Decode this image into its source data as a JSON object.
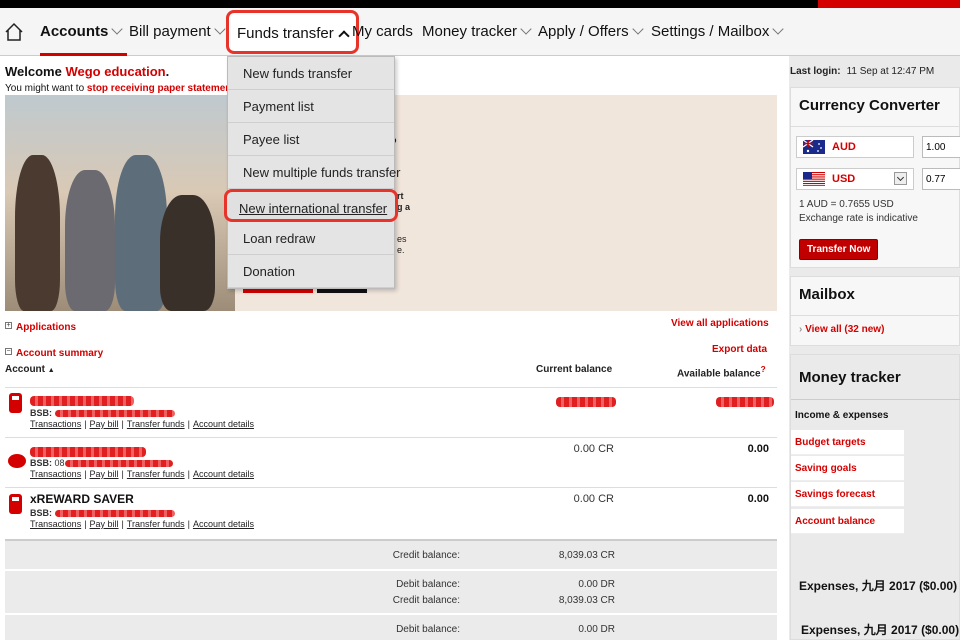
{
  "nav": {
    "items": [
      {
        "label": "Accounts"
      },
      {
        "label": "Bill payment"
      },
      {
        "label": "Funds transfer"
      },
      {
        "label": "My cards"
      },
      {
        "label": "Money tracker"
      },
      {
        "label": "Apply / Offers"
      },
      {
        "label": "Settings / Mailbox"
      }
    ],
    "active": "Accounts",
    "open_menu": "Funds transfer",
    "home_icon": "home-icon"
  },
  "funds_menu": {
    "items": [
      {
        "label": "New funds transfer"
      },
      {
        "label": "Payment list"
      },
      {
        "label": "Payee list"
      },
      {
        "label": "New multiple funds transfer"
      },
      {
        "label": "New international transfer"
      },
      {
        "label": "Loan redraw"
      },
      {
        "label": "Donation"
      }
    ],
    "highlighted": "New international transfer"
  },
  "welcome": {
    "prefix": "Welcome",
    "name": "Wego education",
    "suffix": ".",
    "paper_prefix": "You might want to",
    "paper_link": "stop receiving paper statements"
  },
  "banner": {
    "fragments": [
      "o",
      "rt",
      "g a",
      "es",
      "e."
    ]
  },
  "applications": {
    "label": "Applications",
    "view_all": "View all applications"
  },
  "account_summary": {
    "label": "Account summary",
    "export": "Export data",
    "columns": {
      "account": "Account",
      "current": "Current balance",
      "available": "Available balance"
    },
    "help_mark": "?",
    "row_links": [
      "Transactions",
      "Pay bill",
      "Transfer funds",
      "Account details"
    ],
    "bsb_label": "BSB:",
    "rows": [
      {
        "name": "",
        "bsb_visible": "",
        "current": "",
        "available": "",
        "icon": "calculator-icon"
      },
      {
        "name": "",
        "bsb_visible": "08",
        "current": "0.00 CR",
        "available": "0.00",
        "icon": "piggy-bank-icon"
      },
      {
        "name": "xREWARD SAVER",
        "bsb_visible": "",
        "current": "0.00 CR",
        "available": "0.00",
        "icon": "calculator-icon"
      }
    ],
    "totals": [
      {
        "label": "Credit balance:",
        "value": "8,039.03 CR"
      },
      {
        "label": "Debit balance:",
        "value": "0.00 DR"
      },
      {
        "label": "Credit balance:",
        "value": "8,039.03 CR"
      },
      {
        "label": "Debit balance:",
        "value": "0.00 DR"
      }
    ]
  },
  "sidebar": {
    "last_login_label": "Last login:",
    "last_login_value": "11 Sep at 12:47 PM",
    "currency": {
      "title": "Currency Converter",
      "from_code": "AUD",
      "from_value": "1.00",
      "to_code": "USD",
      "to_value": "0.77",
      "rate": "1 AUD = 0.7655 USD",
      "note": "Exchange rate is indicative",
      "button": "Transfer Now"
    },
    "mailbox": {
      "title": "Mailbox",
      "link": "View all (32 new)"
    },
    "money_tracker": {
      "title": "Money tracker",
      "section": "Income & expenses",
      "items": [
        "Budget targets",
        "Saving goals",
        "Savings forecast",
        "Account balance"
      ],
      "expenses": [
        "Expenses, 九月 2017 ($0.00)",
        "Expenses, 九月 2017 ($0.00)"
      ]
    }
  },
  "colors": {
    "brand_red": "#d40000",
    "highlight_red": "#e8332a"
  }
}
